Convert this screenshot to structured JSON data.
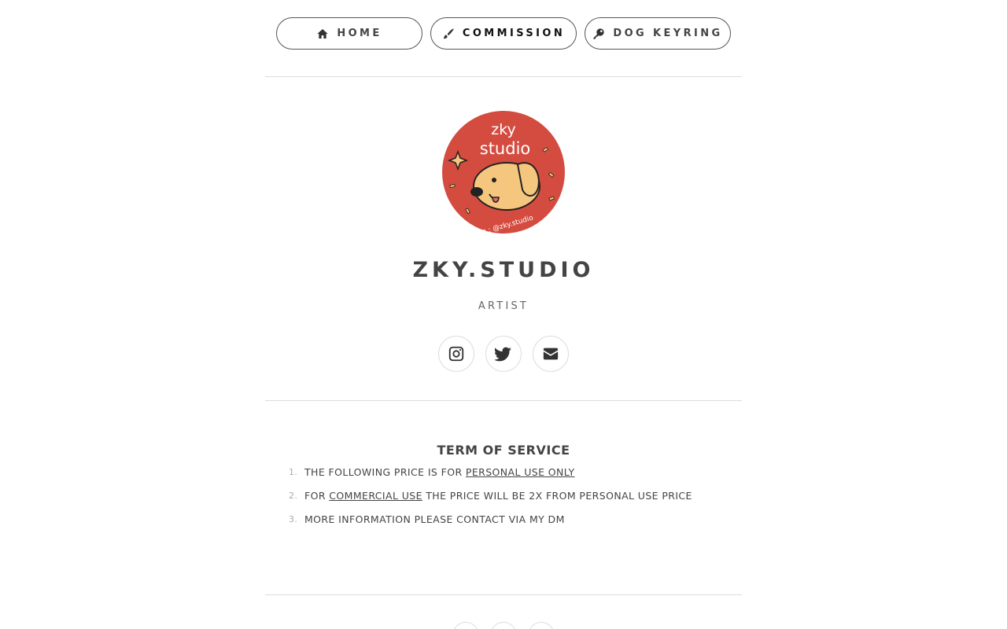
{
  "nav": {
    "items": [
      {
        "label": "HOME",
        "icon": "home-icon"
      },
      {
        "label": "COMMISSION",
        "icon": "paintbrush-icon"
      },
      {
        "label": "DOG KEYRING",
        "icon": "key-icon"
      }
    ]
  },
  "avatar": {
    "text_line1": "zky",
    "text_line2": "studio",
    "handle": "ig : @zky.studio",
    "bg_color": "#d44b3f",
    "dog_color": "#f5c77e"
  },
  "profile": {
    "name": "ZKY.STUDIO",
    "role": "ARTIST"
  },
  "socials": [
    {
      "icon": "instagram-icon"
    },
    {
      "icon": "twitter-icon"
    },
    {
      "icon": "envelope-icon"
    }
  ],
  "tos": {
    "title": "TERM OF SERVICE",
    "items": [
      {
        "num": "1.",
        "pre": "THE FOLLOWING PRICE IS FOR ",
        "link": "PERSONAL USE ONLY",
        "post": ""
      },
      {
        "num": "2.",
        "pre": "FOR ",
        "link": "COMMERCIAL USE",
        "post": " THE PRICE WILL BE 2X FROM PERSONAL USE PRICE"
      },
      {
        "num": "3.",
        "pre": "MORE INFORMATION PLEASE CONTACT VIA MY DM",
        "link": "",
        "post": ""
      }
    ]
  }
}
